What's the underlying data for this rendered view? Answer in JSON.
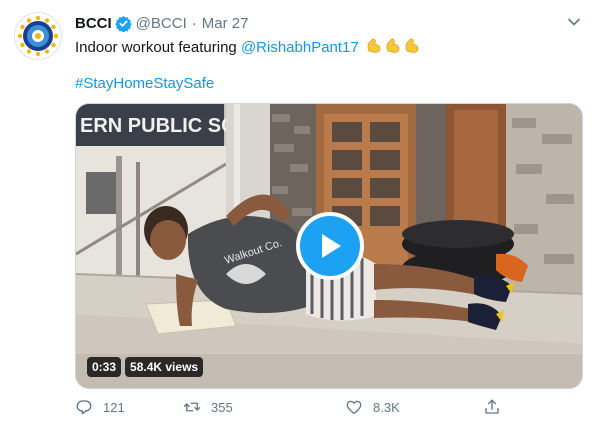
{
  "tweet": {
    "author_name": "BCCI",
    "handle": "@BCCI",
    "separator": "·",
    "date": "Mar 27",
    "text_prefix": "Indoor workout featuring ",
    "mention": "@RishabhPant17",
    "emoji": "💪💪💪",
    "hashtag": "#StayHomeStaySafe"
  },
  "media": {
    "signboard_text": "ERN PUBLIC SCHOO",
    "shirt_text": "Walkout Co.",
    "duration": "0:33",
    "views": "58.4K views"
  },
  "actions": {
    "replies": "121",
    "retweets": "355",
    "likes": "8.3K"
  },
  "colors": {
    "link": "#1b95e0",
    "play_button": "#1da1f2",
    "muted_text": "#657786",
    "verified": "#1da1f2"
  },
  "icons": [
    "bcci-logo-icon",
    "verified-badge-icon",
    "chevron-down-icon",
    "flexed-biceps-icon",
    "play-icon",
    "reply-icon",
    "retweet-icon",
    "like-icon",
    "share-icon"
  ]
}
